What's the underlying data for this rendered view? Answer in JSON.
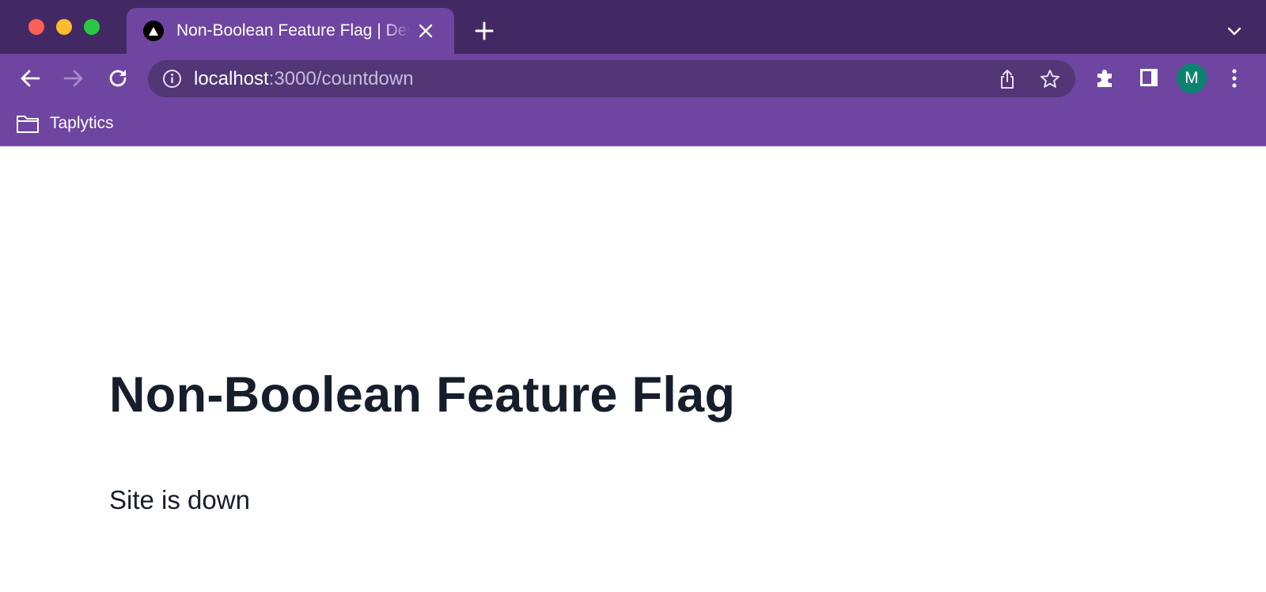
{
  "browser": {
    "tab": {
      "title": "Non-Boolean Feature Flag | Dev",
      "favicon": "triangle-logo-icon"
    },
    "address_bar": {
      "host": "localhost",
      "path": ":3000/countdown"
    },
    "profile_initial": "M",
    "bookmarks": [
      {
        "label": "Taplytics",
        "icon": "folder-icon"
      }
    ],
    "colors": {
      "tabstrip": "#432964",
      "toolbar": "#6e45a0",
      "omnibox": "#523676",
      "avatar": "#0a8471"
    }
  },
  "page": {
    "title": "Non-Boolean Feature Flag",
    "status": "Site is down"
  }
}
